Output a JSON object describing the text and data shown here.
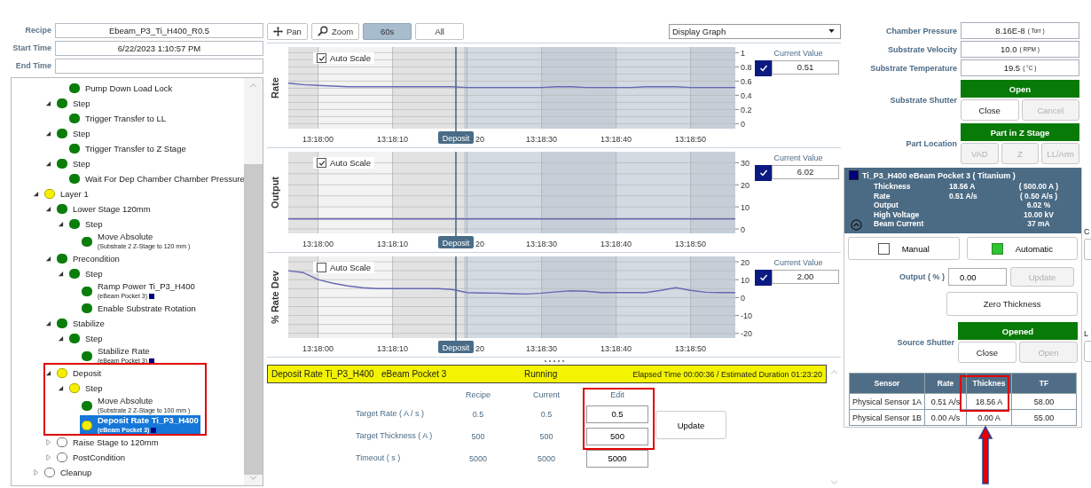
{
  "recipe_info": [
    {
      "label": "Recipe",
      "value": "Ebeam_P3_Ti_H400_R0.5"
    },
    {
      "label": "Start Time",
      "value": "6/22/2023 1:10:57 PM"
    },
    {
      "label": "End Time"
    }
  ],
  "tree": {
    "items": [
      {
        "children": [
          {
            "children": [
              {
                "label": "Pump Down Load Lock",
                "kind": "complete",
                "selected": false
              }
            ]
          },
          {
            "label": "Step",
            "kind": "complete",
            "expanded": true,
            "selected": false,
            "children": [
              {
                "label": "Trigger Transfer to LL",
                "kind": "complete",
                "selected": false
              }
            ]
          },
          {
            "label": "Step",
            "kind": "complete",
            "expanded": true,
            "selected": false,
            "children": [
              {
                "label": "Trigger Transfer to Z Stage",
                "kind": "complete",
                "selected": false
              }
            ]
          },
          {
            "label": "Step",
            "kind": "complete",
            "expanded": true,
            "selected": false,
            "children": [
              {
                "label": "Wait For Dep Chamber Chamber Pressure",
                "kind": "complete",
                "selected": false
              }
            ]
          }
        ]
      },
      {
        "label": "Layer 1",
        "kind": "active",
        "expanded": true,
        "selected": false,
        "children": [
          {
            "label": "Lower Stage 120mm",
            "kind": "complete",
            "expanded": true,
            "selected": false,
            "children": [
              {
                "label": "Step",
                "kind": "complete",
                "expanded": true,
                "selected": false,
                "children": [
                  {
                    "label": "Move Absolute",
                    "sub": "(Substrate 2 Z-Stage to 120 mm )",
                    "kind": "complete",
                    "selected": false
                  }
                ]
              }
            ]
          },
          {
            "label": "Precondition",
            "kind": "complete",
            "expanded": true,
            "selected": false,
            "children": [
              {
                "label": "Step",
                "kind": "complete",
                "expanded": true,
                "selected": false,
                "children": [
                  {
                    "label": "Ramp Power Ti_P3_H400",
                    "sub": "(eBeam Pocket 3)",
                    "pocket": true,
                    "kind": "complete",
                    "selected": false
                  },
                  {
                    "label": "Enable Substrate Rotation",
                    "kind": "complete",
                    "selected": false
                  }
                ]
              }
            ]
          },
          {
            "label": "Stabilize",
            "kind": "complete",
            "expanded": true,
            "selected": false,
            "children": [
              {
                "label": "Step",
                "kind": "complete",
                "expanded": true,
                "selected": false,
                "children": [
                  {
                    "label": "Stabilize Rate",
                    "sub": "(eBeam Pocket 3)",
                    "pocket": true,
                    "kind": "complete",
                    "selected": false
                  }
                ]
              }
            ]
          },
          {
            "label": "Deposit",
            "kind": "active",
            "expanded": true,
            "selected": false,
            "children": [
              {
                "label": "Step",
                "kind": "active",
                "expanded": true,
                "selected": false,
                "children": [
                  {
                    "label": "Move Absolute",
                    "sub": "(Substrate 2 Z-Stage to 100 mm )",
                    "kind": "complete",
                    "selected": false
                  },
                  {
                    "label": "Deposit Rate Ti_P3_H400",
                    "sub": "(eBeam Pocket 3)",
                    "pocket": true,
                    "kind": "active",
                    "selected": true
                  }
                ]
              }
            ]
          },
          {
            "label": "Raise Stage to 120mm",
            "kind": "pending",
            "expanded": false,
            "selected": false
          },
          {
            "label": "PostCondition",
            "kind": "pending",
            "expanded": false,
            "selected": false
          }
        ]
      },
      {
        "label": "Cleanup",
        "kind": "pending",
        "expanded": false,
        "selected": false
      }
    ]
  },
  "toolbar": {
    "buttons": [
      {
        "label": "Pan",
        "kind": "pan",
        "selected": false
      },
      {
        "label": "Zoom",
        "kind": "zoom",
        "selected": false
      },
      {
        "label": "60s",
        "kind": "plain",
        "selected": true
      },
      {
        "label": "All",
        "kind": "plain",
        "selected": false
      }
    ],
    "dropdown": "Display Graph"
  },
  "charts": [
    {
      "auto_scale_label": "Auto Scale",
      "auto_scale": true,
      "current_label": "Current Value",
      "current_checked": true,
      "current_value": "0.51",
      "marker_label": "Deposit",
      "cut_tick_label": "20",
      "chart_data": {
        "type": "line",
        "ylabel": "Rate",
        "categories": [
          null,
          null,
          "13:18:00",
          null,
          null,
          null,
          null,
          "13:18:10",
          null,
          null,
          null,
          null,
          null,
          null,
          null,
          null,
          null,
          "13:18:30",
          null,
          null,
          null,
          null,
          "13:18:40",
          null,
          null,
          null,
          null,
          "13:18:50",
          null,
          null,
          null
        ],
        "series": [
          {
            "color": "#6868b4",
            "values": [
              0.57,
              0.55,
              0.54,
              0.53,
              0.52,
              0.52,
              0.52,
              0.52,
              0.52,
              0.52,
              0.52,
              0.52,
              0.51,
              0.51,
              0.51,
              0.51,
              0.51,
              0.51,
              0.52,
              0.52,
              0.51,
              0.51,
              0.51,
              0.51,
              0.52,
              0.52,
              0.52,
              0.51,
              0.51,
              0.51,
              0.51
            ]
          }
        ],
        "grid": true,
        "ylim": [
          -0.07,
          1.08
        ],
        "yticks": [
          0,
          0.2,
          0.4,
          0.6,
          0.8,
          1
        ]
      }
    },
    {
      "auto_scale_label": "Auto Scale",
      "auto_scale": true,
      "current_label": "Current Value",
      "current_checked": true,
      "current_value": "6.02",
      "marker_label": "Deposit",
      "cut_tick_label": "20",
      "chart_data": {
        "type": "line",
        "ylabel": "Output",
        "categories": [
          null,
          null,
          "13:18:00",
          null,
          null,
          null,
          null,
          "13:18:10",
          null,
          null,
          null,
          null,
          null,
          null,
          null,
          null,
          null,
          "13:18:30",
          null,
          null,
          null,
          null,
          "13:18:40",
          null,
          null,
          null,
          null,
          "13:18:50",
          null,
          null,
          null
        ],
        "series": [
          {
            "color": "#6868b4",
            "values": [
              4.5,
              4.5,
              4.5,
              4.5,
              4.5,
              4.5,
              4.5,
              4.5,
              4.5,
              4.5,
              4.5,
              4.5,
              4.5,
              4.5,
              4.5,
              4.5,
              4.5,
              4.5,
              4.5,
              4.5,
              4.5,
              4.5,
              4.5,
              4.5,
              4.5,
              4.5,
              4.5,
              4.5,
              4.5,
              4.5,
              4.5
            ]
          }
        ],
        "grid": true,
        "ylim": [
          -2,
          35
        ],
        "yticks": [
          0,
          10,
          20,
          30
        ]
      }
    },
    {
      "auto_scale_label": "Auto Scale",
      "auto_scale": false,
      "current_label": "Current Value",
      "current_checked": true,
      "current_value": "2.00",
      "marker_label": "Deposit",
      "cut_tick_label": "20",
      "chart_data": {
        "type": "line",
        "ylabel": "% Rate Dev",
        "categories": [
          null,
          null,
          "13:18:00",
          null,
          null,
          null,
          null,
          "13:18:10",
          null,
          null,
          null,
          null,
          null,
          null,
          null,
          null,
          null,
          "13:18:30",
          null,
          null,
          null,
          null,
          "13:18:40",
          null,
          null,
          null,
          null,
          "13:18:50",
          null,
          null,
          null
        ],
        "series": [
          {
            "color": "#6868b4",
            "values": [
              15,
              14,
              10,
              8,
              6.5,
              5.5,
              5,
              5,
              5,
              5,
              5,
              4.5,
              2.8,
              2.6,
              2.5,
              2.2,
              2,
              2.5,
              3.2,
              3.8,
              3.5,
              2.8,
              2.8,
              2.8,
              2.8,
              4,
              5.5,
              4,
              3,
              2.8,
              2.8
            ]
          }
        ],
        "grid": true,
        "ylim": [
          -22.6,
          23
        ],
        "yticks": [
          -20,
          -10,
          0,
          10,
          20
        ]
      }
    }
  ],
  "step_status": {
    "name": "Deposit Rate Ti_P3_H400   eBeam Pocket 3",
    "state": "Running",
    "timing": "Elapsed Time 00:00:36 / Estimated Duration 01:23:20"
  },
  "parameters": {
    "columns": [
      "Recipe",
      "Current",
      "Edit"
    ],
    "rows": [
      {
        "label": "Target Rate ( A / s )",
        "recipe": "0.5",
        "current": "0.5",
        "edit": "0.5"
      },
      {
        "label": "Target Thickness ( A )",
        "recipe": "500",
        "current": "500",
        "edit": "500"
      },
      {
        "label": "Timeout ( s )",
        "recipe": "5000",
        "current": "5000",
        "edit": "5000"
      }
    ],
    "update_button": "Update"
  },
  "readings": [
    {
      "label": "Chamber Pressure",
      "value": "8.16E-8",
      "unit": "( Torr )"
    },
    {
      "label": "Substrate Velocity",
      "value": "10.0",
      "unit": "( RPM )"
    },
    {
      "label": "Substrate Temperature",
      "value": "19.5",
      "unit": "( °C )"
    }
  ],
  "substrate_shutter": {
    "label": "Substrate Shutter",
    "status": "Open",
    "buttons": [
      {
        "label": "Close",
        "disabled": false
      },
      {
        "label": "Cancel",
        "disabled": true
      }
    ]
  },
  "part_location": {
    "label": "Part Location",
    "status": "Part in Z Stage",
    "buttons": [
      {
        "label": "VAD",
        "disabled": true
      },
      {
        "label": "Z",
        "disabled": true
      },
      {
        "label": "LL/Arm",
        "disabled": true
      }
    ]
  },
  "source": {
    "title": "Ti_P3_H400  eBeam Pocket 3 ( Titanium )",
    "rows": [
      {
        "label": "Thickness",
        "value": "18.56 A",
        "target": "( 500.00 A )"
      },
      {
        "label": "Rate",
        "value": "0.51 A/s",
        "target": "( 0.50 A/s )"
      },
      {
        "label": "Output",
        "target": "6.02 %"
      },
      {
        "label": "High Voltage",
        "target": "10.00 kV"
      },
      {
        "label": "Beam Current",
        "target": "37 mA"
      }
    ]
  },
  "modes": [
    {
      "label": "Manual",
      "selected": false
    },
    {
      "label": "Automatic",
      "selected": true
    }
  ],
  "output_control": {
    "label": "Output ( % )",
    "value": "0.00",
    "button": {
      "label": "Update",
      "disabled": true
    }
  },
  "zero_button": "Zero Thickness",
  "source_shutter": {
    "label": "Source Shutter",
    "status": "Opened",
    "buttons": [
      {
        "label": "Close",
        "disabled": false
      },
      {
        "label": "Open",
        "disabled": true
      }
    ]
  },
  "sensors": {
    "columns": [
      "Sensor",
      "Rate",
      "Thicknes",
      "TF"
    ],
    "rows": [
      [
        "Physical Sensor 1A",
        "0.51 A/s",
        "18.56 A",
        "58.00"
      ],
      [
        "Physical Sensor 1B",
        "0.00 A/s",
        "0.00 A",
        "55.00"
      ]
    ]
  },
  "edge_panel": {
    "labels": [
      "C",
      "L"
    ]
  }
}
